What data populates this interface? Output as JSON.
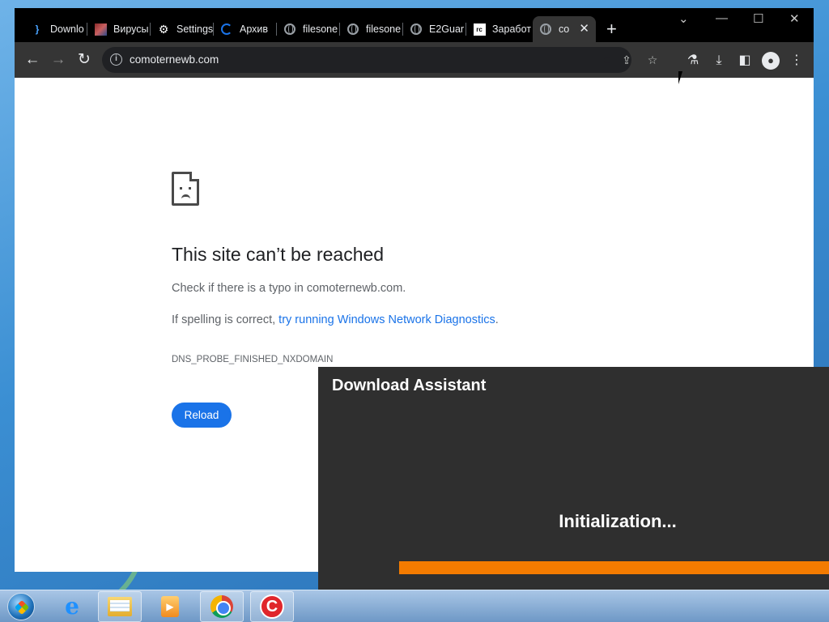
{
  "browser": {
    "tabs": [
      {
        "title": "Downlo",
        "favicon": "curly-bracket-icon",
        "active": false
      },
      {
        "title": "Вирусы",
        "favicon": "image-favicon",
        "active": false
      },
      {
        "title": "Settings",
        "favicon": "gear-icon",
        "active": false
      },
      {
        "title": "Архив",
        "favicon": "loading-ring-icon",
        "active": false
      },
      {
        "title": "filesone",
        "favicon": "globe-icon",
        "active": false
      },
      {
        "title": "filesone",
        "favicon": "globe-icon",
        "active": false
      },
      {
        "title": "E2Guar",
        "favicon": "globe-icon",
        "active": false
      },
      {
        "title": "Заработ",
        "favicon": "rc-icon",
        "active": false
      },
      {
        "title": "co",
        "favicon": "globe-icon",
        "active": true
      }
    ],
    "new_tab_label": "+",
    "address": "comoternewb.com",
    "colors": {
      "chrome_dark": "#353535",
      "tabstrip": "#000000",
      "link": "#1a73e8"
    }
  },
  "error_page": {
    "title": "This site can’t be reached",
    "typo_hint": "Check if there is a typo in comoternewb.com.",
    "spelling_prefix": "If spelling is correct, ",
    "diagnostics_link": "try running Windows Network Diagnostics",
    "spelling_suffix": ".",
    "error_code": "DNS_PROBE_FINISHED_NXDOMAIN",
    "reload_label": "Reload"
  },
  "download_assistant": {
    "title": "Download Assistant",
    "status": "Initialization...",
    "progress_color": "#f47b00"
  },
  "taskbar": {
    "items": [
      "start-orb",
      "internet-explorer-icon",
      "file-explorer-icon",
      "media-player-icon",
      "chrome-icon",
      "ccleaner-icon"
    ]
  }
}
